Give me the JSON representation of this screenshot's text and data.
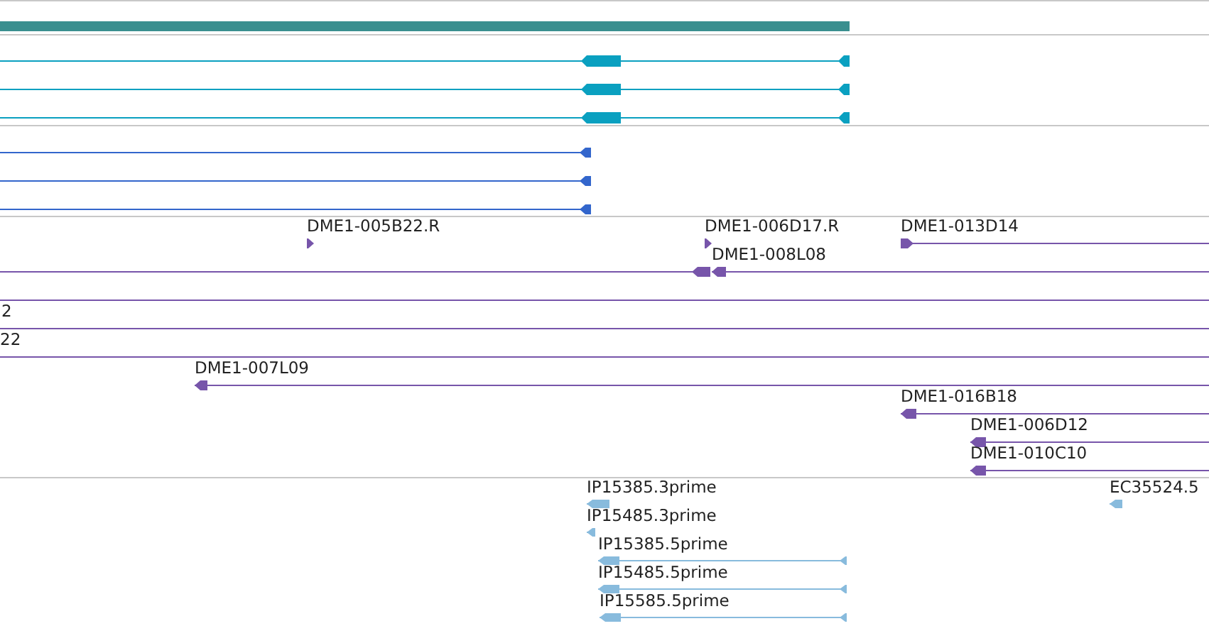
{
  "tracks": [
    {
      "color": "#3a8f8f",
      "features": [
        {
          "kind": "bar"
        }
      ]
    },
    {
      "color": "#0aa0c0",
      "features": [
        {
          "kind": "transcript",
          "reverse": true
        },
        {
          "kind": "transcript",
          "reverse": true
        },
        {
          "kind": "transcript",
          "reverse": true
        }
      ]
    },
    {
      "color": "#3366cc",
      "features": [
        {
          "kind": "transcript",
          "reverse": true
        },
        {
          "kind": "transcript",
          "reverse": true
        },
        {
          "kind": "transcript",
          "reverse": true
        }
      ]
    },
    {
      "color": "#7755aa",
      "features": [
        {
          "kind": "marker",
          "reverse": false,
          "label": "DME1-005B22.R"
        },
        {
          "kind": "marker",
          "reverse": false,
          "label": "DME1-006D17.R"
        },
        {
          "kind": "read",
          "reverse": false,
          "label": "DME1-013D14"
        },
        {
          "kind": "read",
          "reverse": true
        },
        {
          "kind": "read",
          "reverse": true,
          "label": "DME1-008L08"
        },
        {
          "kind": "read"
        },
        {
          "kind": "read",
          "label": "2"
        },
        {
          "kind": "read",
          "label": "22"
        },
        {
          "kind": "read",
          "reverse": true,
          "label": "DME1-007L09"
        },
        {
          "kind": "read",
          "reverse": true,
          "label": "DME1-016B18"
        },
        {
          "kind": "read",
          "reverse": true,
          "label": "DME1-006D12"
        },
        {
          "kind": "read",
          "reverse": true,
          "label": "DME1-010C10"
        }
      ]
    },
    {
      "color": "#88bbdd",
      "features": [
        {
          "kind": "read",
          "reverse": true,
          "label": "IP15385.3prime"
        },
        {
          "kind": "read",
          "reverse": true,
          "label": "EC35524.5"
        },
        {
          "kind": "read",
          "reverse": true,
          "label": "IP15485.3prime"
        },
        {
          "kind": "read",
          "reverse": true,
          "label": "IP15385.5prime"
        },
        {
          "kind": "read",
          "reverse": true,
          "label": "IP15485.5prime"
        },
        {
          "kind": "read",
          "reverse": true,
          "label": "IP15585.5prime"
        }
      ]
    }
  ]
}
